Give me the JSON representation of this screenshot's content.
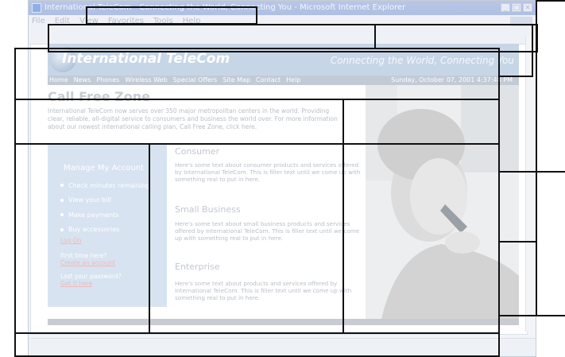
{
  "window": {
    "title": "International TeleCom - Connecting the World, Connecting You - Microsoft Internet Explorer",
    "controls": [
      "_",
      "□",
      "×"
    ],
    "menu": [
      "File",
      "Edit",
      "View",
      "Favorites",
      "Tools",
      "Help"
    ]
  },
  "site": {
    "logo": "International TeleCom",
    "tagline": "Connecting the World, Connecting You",
    "nav": [
      "Home",
      "News",
      "Phones",
      "Wireless Web",
      "Special Offers",
      "Site Map",
      "Contact",
      "Help"
    ],
    "date": "Sunday, October 07, 2001 4:37:48 PM"
  },
  "main": {
    "title": "Call Free Zone",
    "intro": "International TeleCom now serves over 350 major metropolitan centers in the world. Providing clear, reliable, all-digital service to consumers and business the world over. For more information about our newest international calling plan, Call Free Zone, click here."
  },
  "account": {
    "title": "Manage My Account",
    "items": [
      "Check minutes remaining",
      "View your bill",
      "Make payments",
      "Buy accessories"
    ],
    "logon": "Log On",
    "first_time": "First time here?",
    "create_account": "Create an account",
    "lost_password": "Lost your password?",
    "get_it": "Get it here"
  },
  "sections": [
    {
      "heading": "Consumer",
      "text": "Here's some text about consumer products and services offered by International TeleCom. This is filler text until we come up with something real to put in here."
    },
    {
      "heading": "Small Business",
      "text": "Here's some text about small business products and services offered by International TeleCom. This is filler text until we come up with something real to put in here."
    },
    {
      "heading": "Enterprise",
      "text": "Here's some text about products and services offered by International TeleCom. This is filler text until we come up with something real to put in here."
    }
  ]
}
